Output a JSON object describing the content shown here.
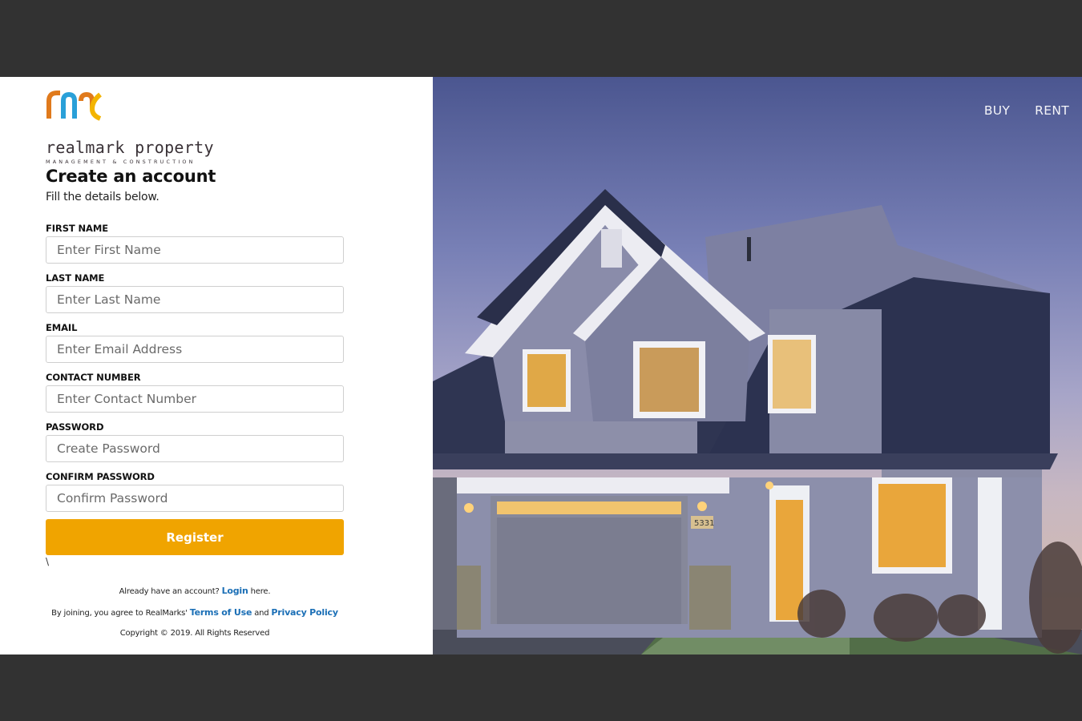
{
  "brand": {
    "name": "realmark property",
    "tagline": "MANAGEMENT & CONSTRUCTION",
    "colors": {
      "orange": "#e07a1c",
      "blue": "#2aa0d8",
      "yellow": "#f3b400",
      "accent": "#f0a400",
      "link": "#1b6fb6"
    }
  },
  "form": {
    "title": "Create an account",
    "subtitle": "Fill the details below.",
    "fields": [
      {
        "label": "FIRST NAME",
        "placeholder": "Enter First Name"
      },
      {
        "label": "LAST NAME",
        "placeholder": "Enter Last Name"
      },
      {
        "label": "EMAIL",
        "placeholder": "Enter Email Address"
      },
      {
        "label": "CONTACT NUMBER",
        "placeholder": "Enter Contact Number"
      },
      {
        "label": "PASSWORD",
        "placeholder": "Create Password"
      },
      {
        "label": "CONFIRM PASSWORD",
        "placeholder": "Confirm Password"
      }
    ],
    "register_label": "Register",
    "stray_char": "\\"
  },
  "footer": {
    "login_prefix": "Already have an account?",
    "login_link": "Login",
    "login_suffix": "here.",
    "terms_prefix": "By joining, you agree to RealMarks'",
    "terms_link": "Terms of Use",
    "terms_and": "and",
    "privacy_link": "Privacy Policy",
    "copyright": "Copyright © 2019. All Rights Reserved"
  },
  "nav": {
    "buy": "BUY",
    "rent": "RENT"
  },
  "hero": {
    "house_number": "5331"
  }
}
